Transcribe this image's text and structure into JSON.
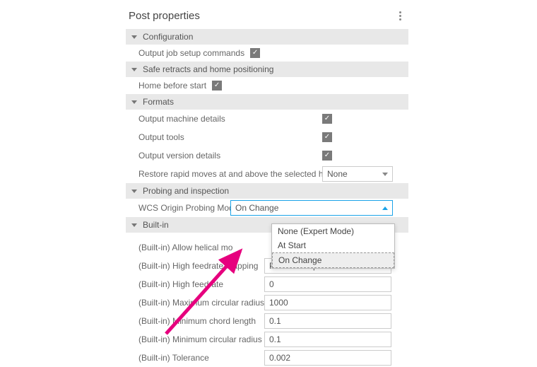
{
  "panel": {
    "title": "Post properties"
  },
  "sections": {
    "configuration": {
      "title": "Configuration"
    },
    "safe_retracts": {
      "title": "Safe retracts and home positioning"
    },
    "formats": {
      "title": "Formats"
    },
    "probing": {
      "title": "Probing and inspection"
    },
    "builtin": {
      "title": "Built-in"
    }
  },
  "fields": {
    "output_job_setup": {
      "label": "Output job setup commands"
    },
    "home_before_start": {
      "label": "Home before start"
    },
    "output_machine_details": {
      "label": "Output machine details"
    },
    "output_tools": {
      "label": "Output tools"
    },
    "output_version_details": {
      "label": "Output version details"
    },
    "restore_rapid": {
      "label": "Restore rapid moves at and above the selected height",
      "value": "None"
    },
    "wcs_mode": {
      "label": "WCS Origin Probing Mode",
      "value": "On Change",
      "options": [
        "None (Expert Mode)",
        "At Start",
        "On Change"
      ]
    },
    "allow_helical": {
      "label": "(Built-in) Allow helical mo"
    },
    "high_feedrate_mapping": {
      "label": "(Built-in) High feedrate mapping",
      "value": "Preserve rapid movement"
    },
    "high_feedrate": {
      "label": "(Built-in) High feedrate",
      "value": "0"
    },
    "max_circ_radius": {
      "label": "(Built-in) Maximum circular radius",
      "value": "1000"
    },
    "min_chord_length": {
      "label": "(Built-in) Minimum chord length",
      "value": "0.1"
    },
    "min_circ_radius": {
      "label": "(Built-in) Minimum circular radius",
      "value": "0.1"
    },
    "tolerance": {
      "label": "(Built-in) Tolerance",
      "value": "0.002"
    }
  }
}
